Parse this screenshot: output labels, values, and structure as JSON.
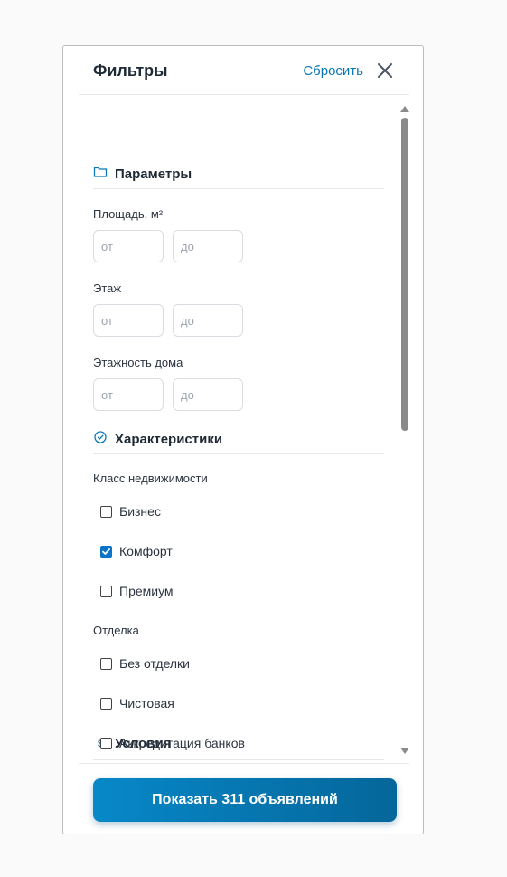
{
  "header": {
    "title": "Фильтры",
    "reset_label": "Сбросить"
  },
  "sections": {
    "params": {
      "title": "Параметры",
      "icon": "folder-icon"
    },
    "features": {
      "title": "Характеристики",
      "icon": "check-circle-icon"
    },
    "conditions": {
      "title": "Условия",
      "icon": "dollar-icon"
    }
  },
  "fields": {
    "area": {
      "label": "Площадь, м²",
      "from_placeholder": "от",
      "to_placeholder": "до"
    },
    "floor": {
      "label": "Этаж",
      "from_placeholder": "от",
      "to_placeholder": "до"
    },
    "floors_total": {
      "label": "Этажность дома",
      "from_placeholder": "от",
      "to_placeholder": "до"
    }
  },
  "property_class": {
    "label": "Класс недвижимости",
    "options": [
      {
        "label": "Бизнес",
        "checked": false
      },
      {
        "label": "Комфорт",
        "checked": true
      },
      {
        "label": "Премиум",
        "checked": false
      }
    ]
  },
  "finish": {
    "label": "Отделка",
    "options": [
      {
        "label": "Без отделки",
        "checked": false
      },
      {
        "label": "Чистовая",
        "checked": false
      }
    ]
  },
  "conditions_options": [
    {
      "label": "Аккредитация банков",
      "checked": false
    }
  ],
  "cta": {
    "label": "Показать 311 объявлений"
  },
  "colors": {
    "accent": "#0a78b6",
    "checkbox_checked": "#0a74c9"
  }
}
